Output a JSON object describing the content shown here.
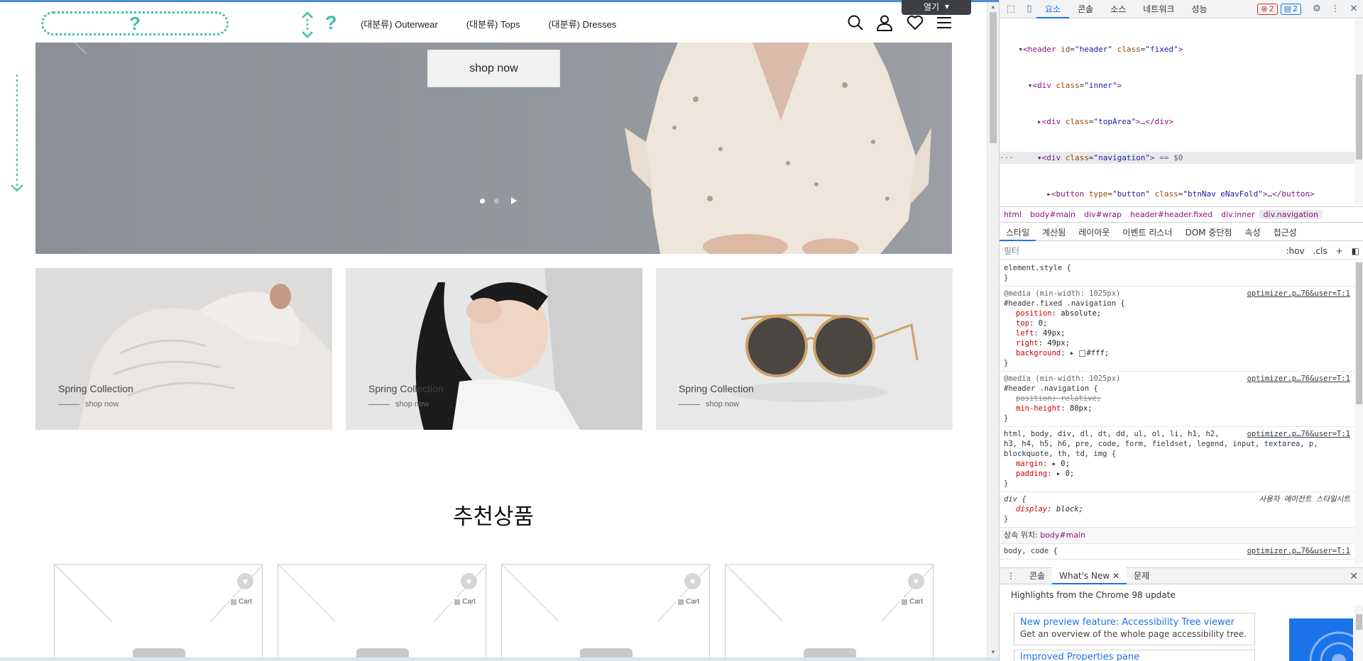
{
  "page": {
    "open_label": "열기"
  },
  "header": {
    "logo_placeholder": "?",
    "nav_fold_label": "?",
    "categories": [
      "(대분류) Outerwear",
      "(대분류) Tops",
      "(대분류) Dresses"
    ]
  },
  "hero": {
    "cta": "shop now"
  },
  "banners": [
    {
      "title": "Spring Collection",
      "sub": "shop now"
    },
    {
      "title": "Spring Collection",
      "sub": "shop now"
    },
    {
      "title": "Spring Collection",
      "sub": "shop now"
    }
  ],
  "recommend": {
    "title": "추천상품",
    "cart_label": "Cart",
    "count": 4
  },
  "devtools": {
    "tabs": [
      "요소",
      "콘솔",
      "소스",
      "네트워크",
      "성능"
    ],
    "active_tab": "요소",
    "error_count": "2",
    "message_count": "2",
    "breadcrumbs": [
      "html",
      "body#main",
      "div#wrap",
      "header#header.fixed",
      "div.inner",
      "div.navigation"
    ],
    "sub_tabs": [
      "스타일",
      "계산됨",
      "레이아웃",
      "이벤트 리스너",
      "DOM 중단점",
      "속성",
      "접근성"
    ],
    "filter_placeholder": "필터",
    "filter_options": [
      ":hov",
      ".cls",
      "+"
    ],
    "inherited_label": "상속 위치:",
    "inherited_from": "body#main",
    "drawer_tabs": [
      "콘솔",
      "What's New",
      "문제"
    ],
    "whats_new_header": "Highlights from the Chrome 98 update",
    "whats_new_card_title": "New preview feature: Accessibility Tree viewer",
    "whats_new_card_desc": "Get an overview of the whole page accessibility tree.",
    "whats_new_card2_title": "Improved Properties pane"
  },
  "icons": {
    "search": "search-icon",
    "user": "user-icon",
    "heart": "heart-icon",
    "menu": "menu-icon"
  },
  "colors": {
    "accent": "#3fbfa4",
    "devtools_blue": "#1a73e8"
  }
}
